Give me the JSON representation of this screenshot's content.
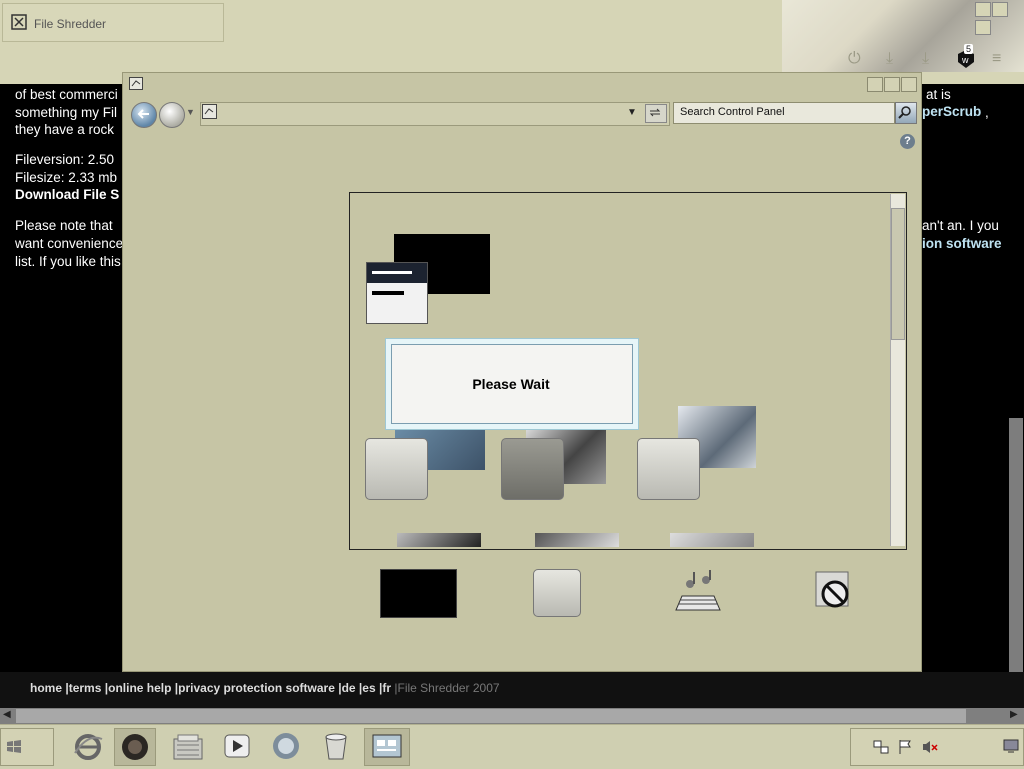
{
  "browser": {
    "tab_title": "File Shredder",
    "badge_count": "5"
  },
  "page": {
    "line1_left": "of best commerci",
    "line1_right": "at is",
    "line2_left": "something my Fil",
    "line2_right_link": "perScrub",
    "line2_right_tail": ",",
    "line3_left": "they have a rock",
    "fileversion": "Fileversion: 2.50",
    "filesize": "Filesize: 2.33 mb",
    "download": "Download File S",
    "note_left": "Please note that",
    "note_right": "an't an. I you",
    "want_left": "want convenience",
    "want_right_link": "ion software",
    "list_left": "list. If you like this"
  },
  "footer": {
    "links": [
      "home",
      "terms",
      "online help",
      "privacy protection software",
      "de",
      "es",
      "fr"
    ],
    "copyright": "File Shredder 2007"
  },
  "control_panel": {
    "search_placeholder": "Search Control Panel",
    "dialog_text": "Please Wait",
    "help_icon": "?"
  },
  "taskbar": {
    "icons": [
      "start-icon",
      "ie-icon",
      "firefox-icon",
      "file-manager-icon",
      "media-player-icon",
      "messenger-icon",
      "recycle-bin-icon",
      "control-panel-icon"
    ],
    "tray": [
      "network-icon",
      "flag-icon",
      "volume-muted-icon",
      "show-desktop-icon"
    ]
  }
}
